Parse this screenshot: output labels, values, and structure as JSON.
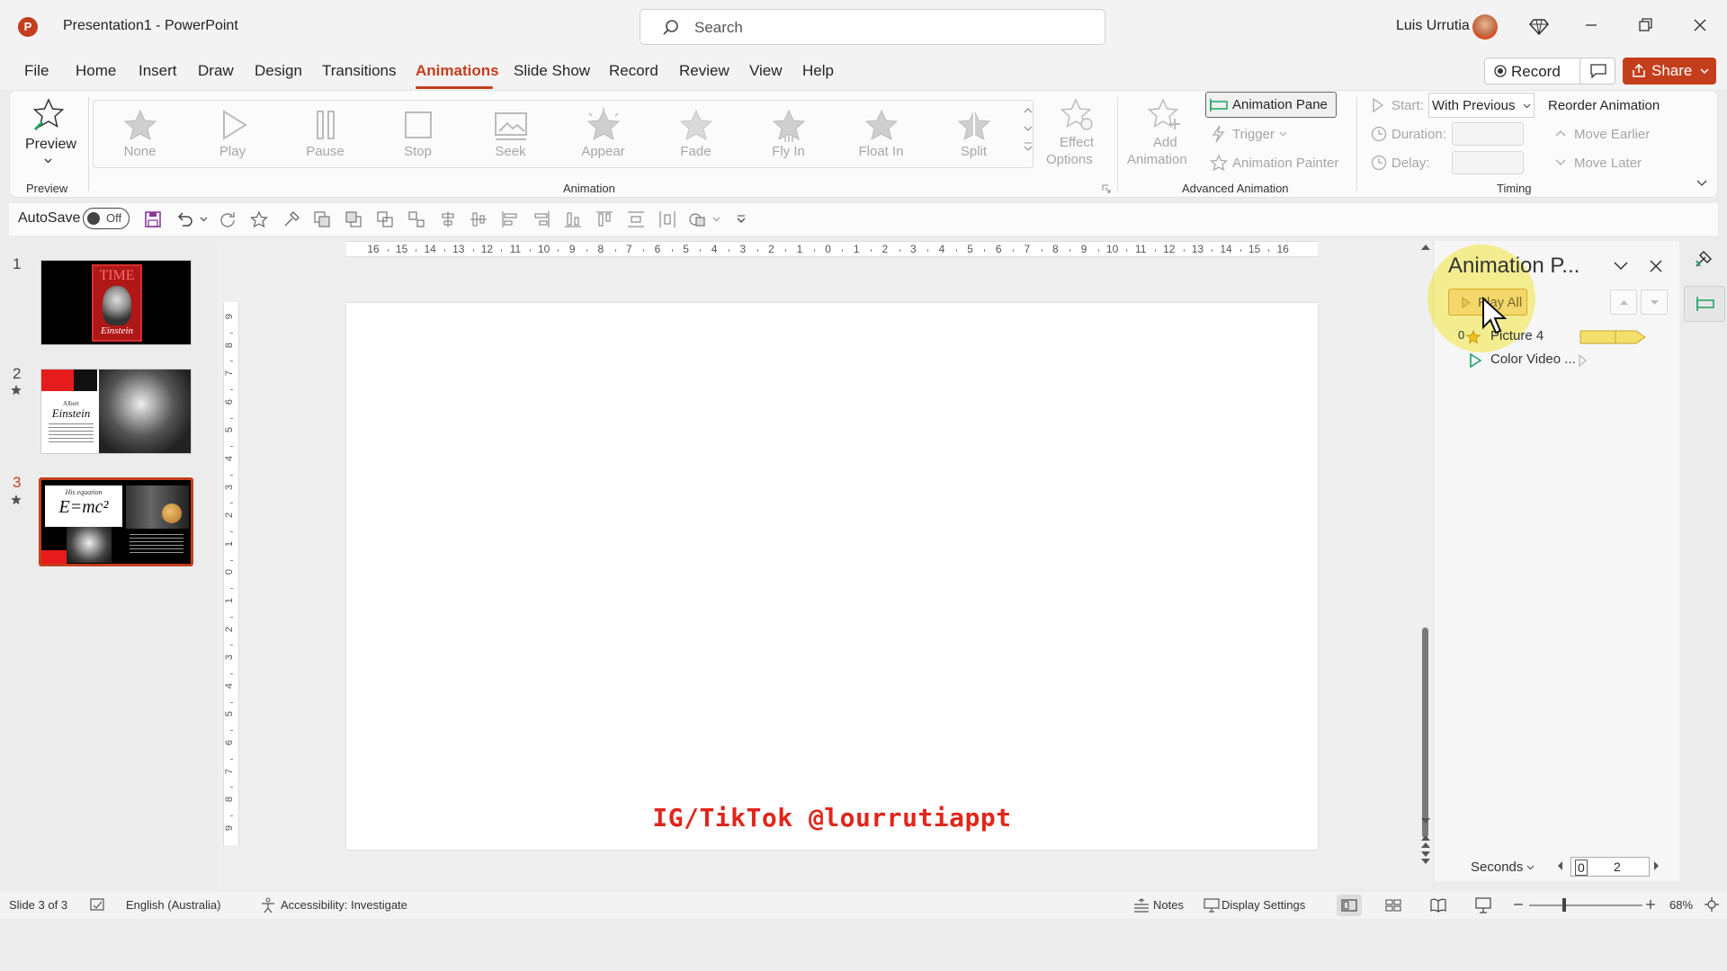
{
  "app": {
    "title": "Presentation1  -  PowerPoint",
    "logo_letter": "P"
  },
  "search": {
    "placeholder": "Search"
  },
  "user": {
    "name": "Luis Urrutia"
  },
  "menu": {
    "tabs": [
      "File",
      "Home",
      "Insert",
      "Draw",
      "Design",
      "Transitions",
      "Animations",
      "Slide Show",
      "Record",
      "Review",
      "View",
      "Help"
    ],
    "active": "Animations",
    "record_label": "Record",
    "share_label": "Share"
  },
  "ribbon": {
    "preview": {
      "button_label": "Preview",
      "group_label": "Preview"
    },
    "animation_gallery": [
      "None",
      "Play",
      "Pause",
      "Stop",
      "Seek",
      "Appear",
      "Fade",
      "Fly In",
      "Float In",
      "Split"
    ],
    "effect_options_line1": "Effect",
    "effect_options_line2": "Options",
    "animation_group_label": "Animation",
    "add_animation_line1": "Add",
    "add_animation_line2": "Animation",
    "animation_pane_label": "Animation Pane",
    "trigger_label": "Trigger",
    "animation_painter_label": "Animation Painter",
    "advanced_group_label": "Advanced Animation",
    "start_label": "Start:",
    "start_value": "With Previous",
    "duration_label": "Duration:",
    "delay_label": "Delay:",
    "reorder_label": "Reorder Animation",
    "move_earlier_label": "Move Earlier",
    "move_later_label": "Move Later",
    "timing_group_label": "Timing"
  },
  "qat": {
    "autosave_label": "AutoSave",
    "autosave_state": "Off"
  },
  "slides": [
    {
      "number": "1",
      "title_text": "TIME",
      "caption": "Einstein"
    },
    {
      "number": "2",
      "small_text": "Albert",
      "caption": "Einstein"
    },
    {
      "number": "3",
      "small_text": "His equation",
      "caption": "E=mc²"
    }
  ],
  "ruler": {
    "h_ticks": [
      "16",
      "15",
      "14",
      "13",
      "12",
      "11",
      "10",
      "9",
      "8",
      "7",
      "6",
      "5",
      "4",
      "3",
      "2",
      "1",
      "0",
      "1",
      "2",
      "3",
      "4",
      "5",
      "6",
      "7",
      "8",
      "9",
      "10",
      "11",
      "12",
      "13",
      "14",
      "15",
      "16"
    ],
    "v_ticks": [
      "9",
      "8",
      "7",
      "6",
      "5",
      "4",
      "3",
      "2",
      "1",
      "0",
      "1",
      "2",
      "3",
      "4",
      "5",
      "6",
      "7",
      "8",
      "9"
    ]
  },
  "slide_canvas": {
    "watermark": "IG/TikTok @lourrutiappt"
  },
  "animation_pane": {
    "title": "Animation P...",
    "play_all": "Play All",
    "items": [
      {
        "index": "0",
        "name": "Picture 4"
      },
      {
        "index": "",
        "name": "Color Video ..."
      }
    ],
    "seconds_label": "Seconds",
    "timeline_start": "0",
    "timeline_mark": "2"
  },
  "status": {
    "slide_info": "Slide 3 of 3",
    "language": "English (Australia)",
    "accessibility": "Accessibility: Investigate",
    "notes": "Notes",
    "display_settings": "Display Settings",
    "zoom": "68%"
  },
  "colors": {
    "accent": "#c43e1c",
    "watermark": "#e0261c",
    "highlight": "#f0e63c"
  }
}
